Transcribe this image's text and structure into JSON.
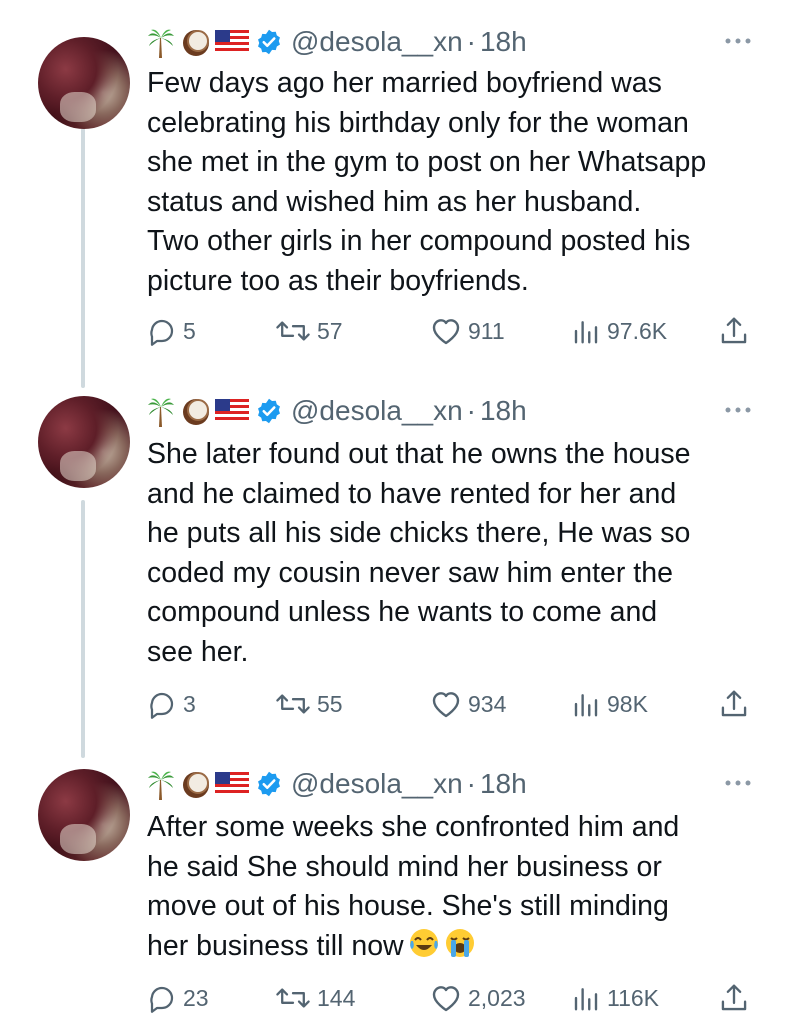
{
  "tweets": [
    {
      "handle": "@desola__xn",
      "separator": "·",
      "time": "18h",
      "text": "Few days ago her married boyfriend was\ncelebrating his birthday only for the woman\nshe met in the gym to post on her Whatsapp\nstatus and wished him as her husband.\nTwo other girls in her compound posted his\npicture too as their boyfriends.",
      "replies": "5",
      "retweets": "57",
      "likes": "911",
      "views": "97.6K"
    },
    {
      "handle": "@desola__xn",
      "separator": "·",
      "time": "18h",
      "text": "She later found out that he owns the house\nand he claimed to have rented for her and\nhe puts all his side chicks there, He was so\ncoded my cousin never saw him enter the\ncompound unless he wants to come and\nsee her.",
      "replies": "3",
      "retweets": "55",
      "likes": "934",
      "views": "98K"
    },
    {
      "handle": "@desola__xn",
      "separator": "·",
      "time": "18h",
      "text": "After some weeks she confronted him and\nhe said She should mind her business or\nmove out of his house. She's still minding\nher business till now",
      "text_emojis": [
        "face-with-tears-of-joy",
        "loudly-crying-face"
      ],
      "replies": "23",
      "retweets": "144",
      "likes": "2,023",
      "views": "116K"
    }
  ],
  "name_emojis": [
    "palm-tree",
    "coconut",
    "us-flag"
  ],
  "colors": {
    "text": "#0f1419",
    "secondary": "#536471",
    "verified": "#1d9bf0",
    "thread_line": "#cfd9de"
  }
}
